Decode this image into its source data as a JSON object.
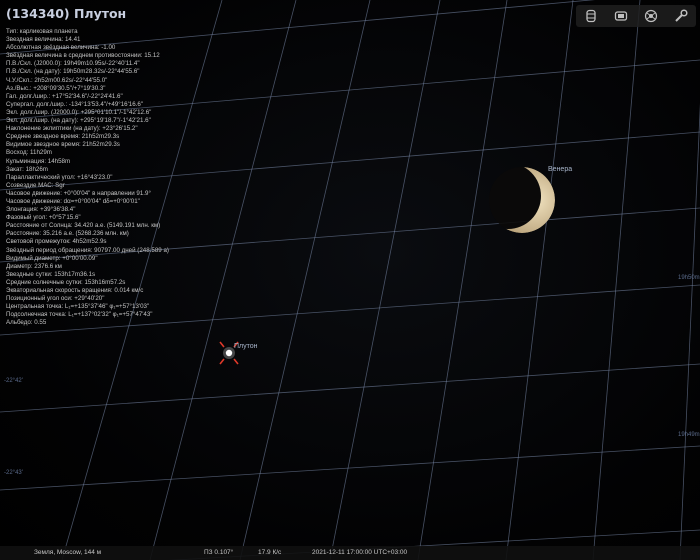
{
  "object": {
    "title": "(134340) Плутон",
    "info_lines": [
      "Тип: карликовая планета",
      "Звездная величина: 14.41",
      "Абсолютная звёздная величина: -1.00",
      "Звёздная величина в среднем противостоянии: 15.12",
      "П.В./Скл. (J2000.0): 19h49m10.95s/-22°40'11.4\"",
      "П.В./Скл. (на дату): 19h50m28.32s/-22°44'55.6\"",
      "Ч.У./Скл.: 2h52m00.62s/-22°44'55.0\"",
      "Аз./Выс.: +208°09'30.5\"/+7°19'30.3\"",
      "Гал. долг./шир.: +17°52'34.6\"/-22°24'41.6\"",
      "Супергал. долг./шир.: -134°13'53.4\"/+49°16'16.6\"",
      "Экл. долг./шир. (J2000.0): +295°01'10.1\"/-1°42'12.6\"",
      "Экл. долг./шир. (на дату): +295°19'18.7\"/-1°42'21.6\"",
      "Наклонение эклиптики (на дату): +23°26'15.2\"",
      "Среднее звездное время: 21h52m29.3s",
      "Видимое звездное время: 21h52m29.3s",
      "Восход: 11h29m",
      "Кульминация: 14h58m",
      "Закат: 18h26m",
      "Параллактический угол: +16°43'23.0\"",
      "Созвездие МАС: Sgr",
      "Часовое движение: +0°00'04\" в направлении 91.9°",
      "Часовое движение: dα=+0°00'04\" dδ=+0°00'01\"",
      "Элонгация: +39°36'38.4\"",
      "Фазовый угол: +0°57'15.6\"",
      "Расстояние от Солнца: 34.420 а.е. (5149.191 млн. км)",
      "Расстояние: 35.216 а.е. (5268.236 млн. км)",
      "Световой промежуток: 4h52m52.9s",
      "Звёздный период обращения: 90797.00 дней (248.589 a)",
      "Видимый диаметр: +0°00'00.09\"",
      "Диаметр: 2376.6 км",
      "Звездные сутки: 153h17m36.1s",
      "Средние солнечные сутки: 153h16m57.2s",
      "Экваториальная скорость вращения: 0.014 км/с",
      "Позиционный угол оси: +29°40'20\"",
      "Центральная точка: L₁=+135°37'46\" φ₁=+57°13'03\"",
      "Подсолнечная точка: L₁=+137°02'32\" φ₁=+57°47'43\"",
      "Альбедо: 0.55"
    ]
  },
  "sky_labels": {
    "venus": "Венера",
    "pluto": "Плутон"
  },
  "toolbar": {
    "buttons": [
      "storage-icon",
      "screen-icon",
      "dish-icon",
      "wrench-icon"
    ]
  },
  "statusbar": {
    "location": "Земля, Moscow, 144 м",
    "fov": "ПЗ 0.107°",
    "fps": "17.9 К/с",
    "datetime": "2021-12-11 17:00:00 UTC+03:00"
  },
  "colors": {
    "background": "#000000",
    "grid": "#7f8fb0",
    "title": "#c8cfe0",
    "marker": "#e0392a"
  }
}
